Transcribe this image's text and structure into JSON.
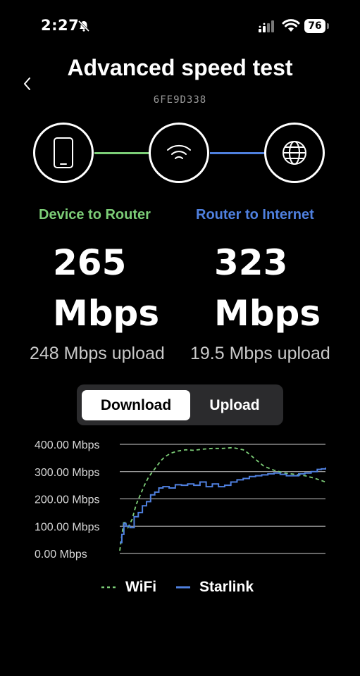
{
  "status_bar": {
    "time": "2:27",
    "battery": "76"
  },
  "header": {
    "title": "Advanced speed test",
    "device_id": "6FE9D338"
  },
  "colors": {
    "green": "#7ccd77",
    "blue": "#4f80df",
    "grid": "#cfcfcf"
  },
  "icons": {
    "device": "phone-icon",
    "router": "wifi-icon",
    "internet": "globe-icon"
  },
  "device_to_router": {
    "label": "Device to Router",
    "download_value": "265",
    "download_unit": "Mbps",
    "upload": "248 Mbps upload"
  },
  "router_to_internet": {
    "label": "Router to Internet",
    "download_value": "323",
    "download_unit": "Mbps",
    "upload": "19.5 Mbps upload"
  },
  "toggle": {
    "download_label": "Download",
    "upload_label": "Upload",
    "selected": "Download"
  },
  "chart_data": {
    "type": "line",
    "ylim": [
      0,
      400
    ],
    "y_ticks": [
      "0.00 Mbps",
      "100.00 Mbps",
      "200.00 Mbps",
      "300.00 Mbps",
      "400.00 Mbps"
    ],
    "x_range": [
      0,
      100
    ],
    "grid": true,
    "legend_position": "bottom",
    "series": [
      {
        "name": "WiFi",
        "style": "dashed",
        "color": "#7ccd77",
        "x": [
          0,
          2,
          4,
          6,
          8,
          10,
          12,
          14,
          16,
          18,
          20,
          22,
          25,
          28,
          32,
          36,
          40,
          45,
          50,
          55,
          60,
          62,
          66,
          70,
          75,
          80,
          85,
          90,
          95,
          100
        ],
        "y": [
          10,
          120,
          95,
          125,
          180,
          215,
          250,
          280,
          300,
          320,
          340,
          355,
          368,
          375,
          380,
          378,
          382,
          385,
          385,
          388,
          380,
          370,
          345,
          320,
          305,
          295,
          290,
          285,
          275,
          262
        ]
      },
      {
        "name": "Starlink",
        "style": "solid",
        "color": "#4f80df",
        "x": [
          0,
          1,
          2,
          3,
          5,
          7,
          9,
          11,
          13,
          15,
          17,
          19,
          21,
          24,
          27,
          30,
          33,
          36,
          39,
          42,
          45,
          48,
          51,
          54,
          57,
          60,
          63,
          66,
          69,
          72,
          75,
          78,
          81,
          84,
          87,
          90,
          93,
          96,
          98,
          100
        ],
        "y": [
          40,
          70,
          110,
          100,
          95,
          135,
          150,
          175,
          190,
          215,
          225,
          240,
          245,
          240,
          252,
          250,
          255,
          250,
          262,
          245,
          255,
          245,
          250,
          262,
          270,
          275,
          282,
          285,
          288,
          292,
          295,
          290,
          285,
          285,
          292,
          295,
          300,
          308,
          310,
          315
        ]
      }
    ]
  }
}
